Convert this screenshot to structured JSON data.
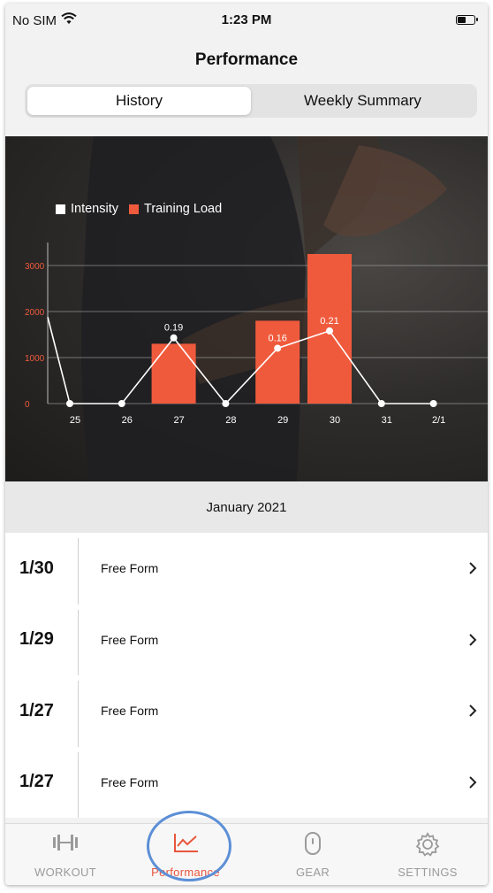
{
  "status_bar": {
    "carrier": "No SIM",
    "time": "1:23 PM"
  },
  "header": {
    "title": "Performance"
  },
  "segments": [
    {
      "label": "History",
      "active": true
    },
    {
      "label": "Weekly Summary",
      "active": false
    }
  ],
  "chart_data": {
    "type": "bar",
    "legend": [
      {
        "name": "Intensity",
        "color": "#ffffff"
      },
      {
        "name": "Training Load",
        "color": "#f05a3c"
      }
    ],
    "categories": [
      "25",
      "26",
      "27",
      "28",
      "29",
      "30",
      "31",
      "2/1"
    ],
    "yticks": [
      0,
      1000,
      2000,
      3000
    ],
    "ylim": [
      0,
      3500
    ],
    "series": [
      {
        "name": "Training Load",
        "type": "bar",
        "values": [
          0,
          0,
          1300,
          0,
          1800,
          3250,
          0,
          0
        ]
      },
      {
        "name": "Intensity",
        "type": "line",
        "values": [
          0,
          0,
          0.19,
          0,
          0.16,
          0.21,
          0,
          0
        ],
        "labels": [
          "",
          "",
          "0.19",
          "",
          "0.16",
          "0.21",
          "",
          ""
        ]
      }
    ],
    "intensity_line_start": 0.25,
    "grid": true
  },
  "month_header": "January 2021",
  "sessions": [
    {
      "date": "1/30",
      "name": "Free Form"
    },
    {
      "date": "1/29",
      "name": "Free Form"
    },
    {
      "date": "1/27",
      "name": "Free Form"
    },
    {
      "date": "1/27",
      "name": "Free Form"
    }
  ],
  "tabs": [
    {
      "label": "WORKOUT",
      "icon": "dumbbell-icon",
      "active": false
    },
    {
      "label": "Performance",
      "icon": "chart-line-icon",
      "active": true
    },
    {
      "label": "GEAR",
      "icon": "device-icon",
      "active": false
    },
    {
      "label": "SETTINGS",
      "icon": "gear-icon",
      "active": false
    }
  ],
  "colors": {
    "accent": "#f05a3c",
    "tab_active": "#e8553c",
    "highlight": "#5c8fd6"
  }
}
